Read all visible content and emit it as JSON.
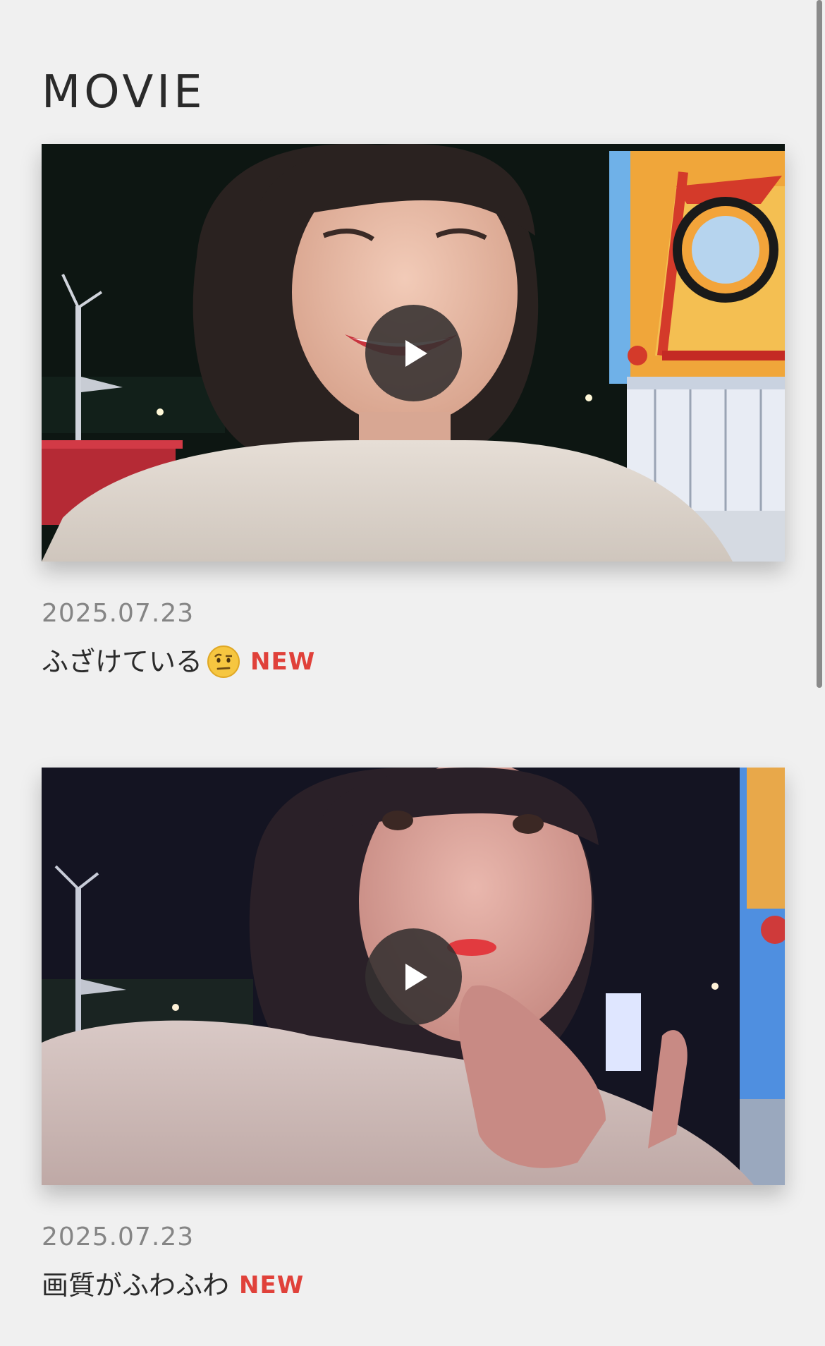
{
  "section": {
    "title": "MOVIE"
  },
  "movies": [
    {
      "date": "2025.07.23",
      "title": "ふざけている",
      "emoji": "face-with-raised-eyebrow-icon",
      "badge": "NEW"
    },
    {
      "date": "2025.07.23",
      "title": "画質がふわふわ",
      "badge": "NEW"
    }
  ],
  "colors": {
    "background": "#f0f0f0",
    "new_badge": "#e0413a",
    "date_text": "#858585",
    "play_button": "#343030"
  }
}
